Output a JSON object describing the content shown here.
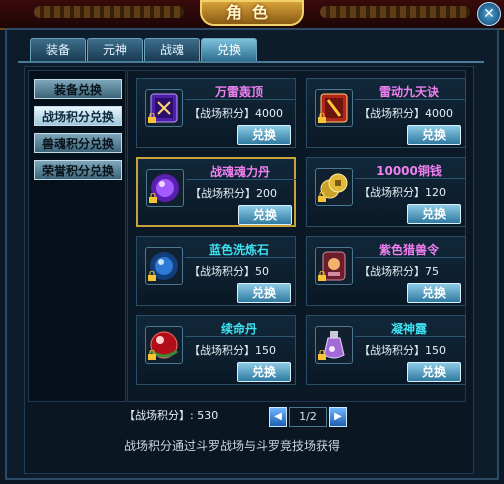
{
  "window": {
    "title": "角色",
    "close_icon": "close-icon"
  },
  "tabs": [
    {
      "label": "装备",
      "active": false
    },
    {
      "label": "元神",
      "active": false
    },
    {
      "label": "战魂",
      "active": false
    },
    {
      "label": "兑换",
      "active": true
    }
  ],
  "menu": [
    {
      "label": "装备兑换",
      "active": false
    },
    {
      "label": "战场积分兑换",
      "active": true
    },
    {
      "label": "兽魂积分兑换",
      "active": false
    },
    {
      "label": "荣誉积分兑换",
      "active": false
    }
  ],
  "items": [
    {
      "name": "万雷轰顶",
      "cost": "【战场积分】4000",
      "button": "兑换",
      "icon": "purple-book-icon",
      "color": "#f07ff0"
    },
    {
      "name": "雷动九天诀",
      "cost": "【战场积分】4000",
      "button": "兑换",
      "icon": "red-book-icon",
      "color": "#f07ff0"
    },
    {
      "name": "战魂魂力丹",
      "cost": "【战场积分】200",
      "button": "兑换",
      "icon": "purple-orb-icon",
      "color": "#f07ff0"
    },
    {
      "name": "10000铜钱",
      "cost": "【战场积分】120",
      "button": "兑换",
      "icon": "coins-icon",
      "color": "#f07ff0"
    },
    {
      "name": "蓝色洗炼石",
      "cost": "【战场积分】50",
      "button": "兑换",
      "icon": "blue-stone-icon",
      "color": "#3fe0ef"
    },
    {
      "name": "紫色猎兽令",
      "cost": "【战场积分】75",
      "button": "兑换",
      "icon": "hunt-token-icon",
      "color": "#f07ff0"
    },
    {
      "name": "续命丹",
      "cost": "【战场积分】150",
      "button": "兑换",
      "icon": "red-pill-icon",
      "color": "#3fe0ef"
    },
    {
      "name": "凝神露",
      "cost": "【战场积分】150",
      "button": "兑换",
      "icon": "potion-icon",
      "color": "#3fe0ef"
    }
  ],
  "footer": {
    "score_label": "【战场积分】: 530",
    "page": "1/2",
    "prev_icon": "prev-arrow-icon",
    "next_icon": "next-arrow-icon",
    "hint": "战场积分通过斗罗战场与斗罗竞技场获得"
  }
}
